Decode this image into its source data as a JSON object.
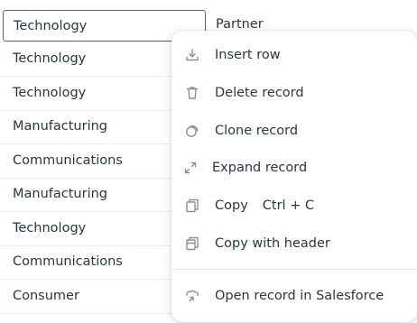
{
  "grid": {
    "rows": [
      {
        "industry": "Technology",
        "type": "Partner"
      },
      {
        "industry": "Technology",
        "type": ""
      },
      {
        "industry": "Technology",
        "type": ""
      },
      {
        "industry": "Manufacturing",
        "type": ""
      },
      {
        "industry": "Communications",
        "type": ""
      },
      {
        "industry": "Manufacturing",
        "type": ""
      },
      {
        "industry": "Technology",
        "type": ""
      },
      {
        "industry": "Communications",
        "type": ""
      },
      {
        "industry": "Consumer",
        "type": ""
      }
    ]
  },
  "context_menu": {
    "insert_row": "Insert row",
    "delete_record": "Delete record",
    "clone_record": "Clone record",
    "expand_record": "Expand record",
    "copy": "Copy",
    "copy_shortcut": "Ctrl + C",
    "copy_with_header": "Copy with header",
    "open_in_salesforce": "Open record in Salesforce"
  },
  "colors": {
    "selection_border": "#4f5ad0",
    "icon_gray": "#8a8f9c",
    "grid_line": "#ebedf0"
  }
}
